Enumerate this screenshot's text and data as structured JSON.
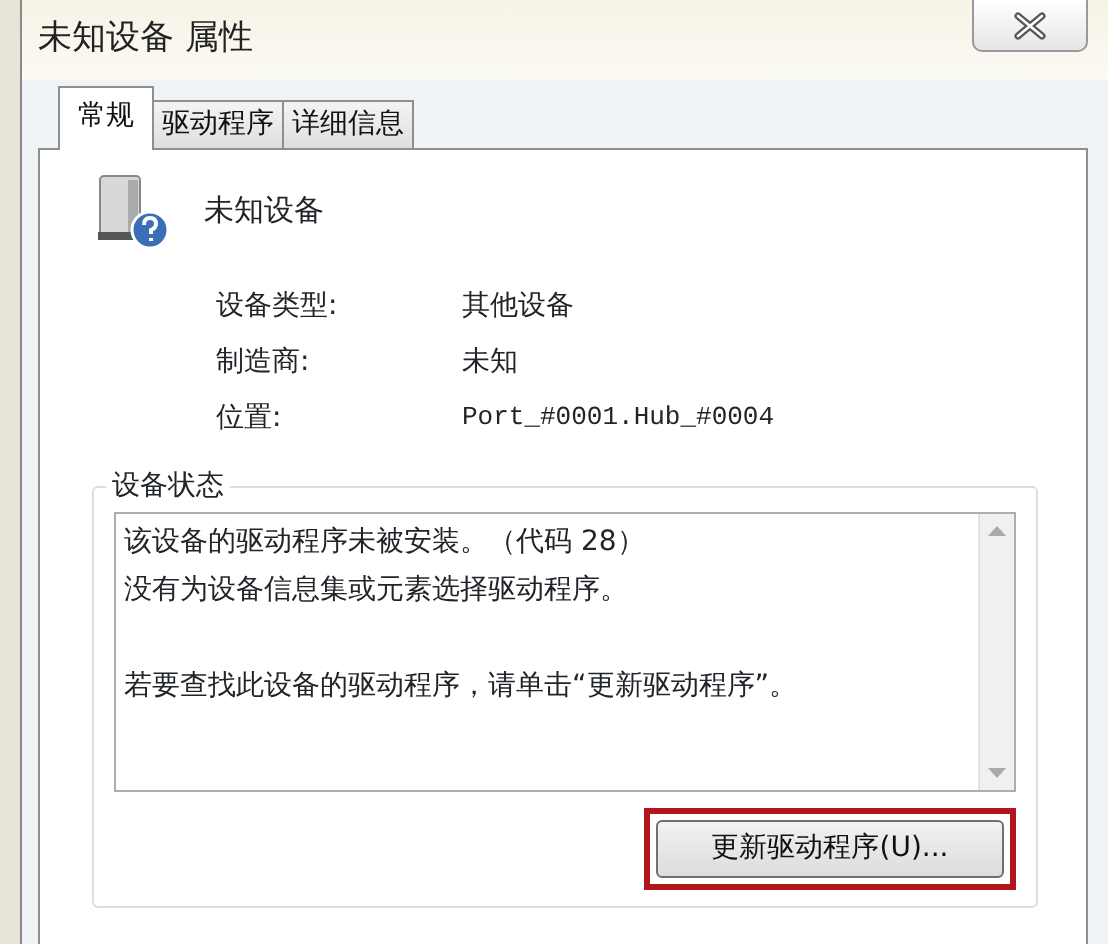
{
  "window": {
    "title": "未知设备 属性"
  },
  "tabs": [
    {
      "label": "常规",
      "selected": true
    },
    {
      "label": "驱动程序",
      "selected": false
    },
    {
      "label": "详细信息",
      "selected": false
    }
  ],
  "device": {
    "name": "未知设备"
  },
  "properties": [
    {
      "label": "设备类型:",
      "value": "其他设备",
      "kind": "text"
    },
    {
      "label": "制造商:",
      "value": "未知",
      "kind": "text"
    },
    {
      "label": "位置:",
      "value": "Port_#0001.Hub_#0004",
      "kind": "code"
    }
  ],
  "status": {
    "title": "设备状态",
    "paragraphs": [
      [
        "该设备的驱动程序未被安装。（代码 28）",
        "没有为设备信息集或元素选择驱动程序。"
      ],
      [
        "若要查找此设备的驱动程序，请单击“更新驱动程序”。"
      ]
    ]
  },
  "update_button": {
    "label": "更新驱动程序(U)...",
    "highlighted": true
  }
}
